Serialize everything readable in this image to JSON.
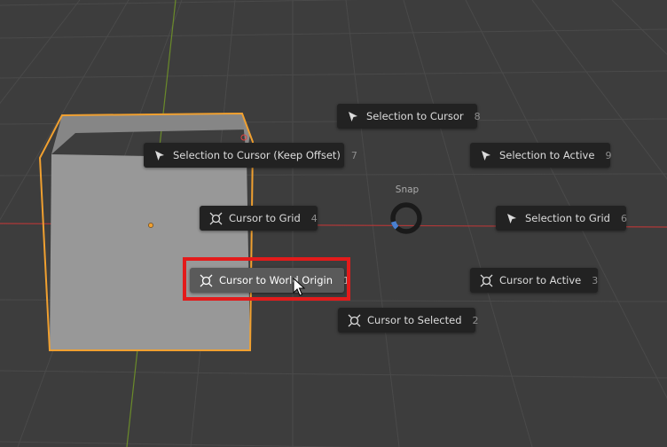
{
  "pie_menu": {
    "title": "Snap",
    "items": [
      {
        "label": "Selection to Cursor",
        "key": "8",
        "icon": "arrow-cursor-icon"
      },
      {
        "label": "Selection to Cursor (Keep Offset)",
        "key": "7",
        "icon": "arrow-cursor-icon"
      },
      {
        "label": "Selection to Active",
        "key": "9",
        "icon": "arrow-cursor-icon"
      },
      {
        "label": "Cursor to Grid",
        "key": "4",
        "icon": "3d-cursor-icon"
      },
      {
        "label": "Selection to Grid",
        "key": "6",
        "icon": "arrow-cursor-icon"
      },
      {
        "label": "Cursor to World Origin",
        "key": "1",
        "icon": "3d-cursor-icon",
        "active": true
      },
      {
        "label": "Cursor to Active",
        "key": "3",
        "icon": "3d-cursor-icon"
      },
      {
        "label": "Cursor to Selected",
        "key": "2",
        "icon": "3d-cursor-icon"
      }
    ]
  },
  "colors": {
    "viewport_bg": "#3d3d3d",
    "item_bg": "#222222",
    "item_active_bg": "#5a5a5a",
    "highlight": "#e31b1b",
    "selection_outline": "#f0a030",
    "x_axis": "#b03838",
    "y_axis": "#6a8a2a"
  }
}
